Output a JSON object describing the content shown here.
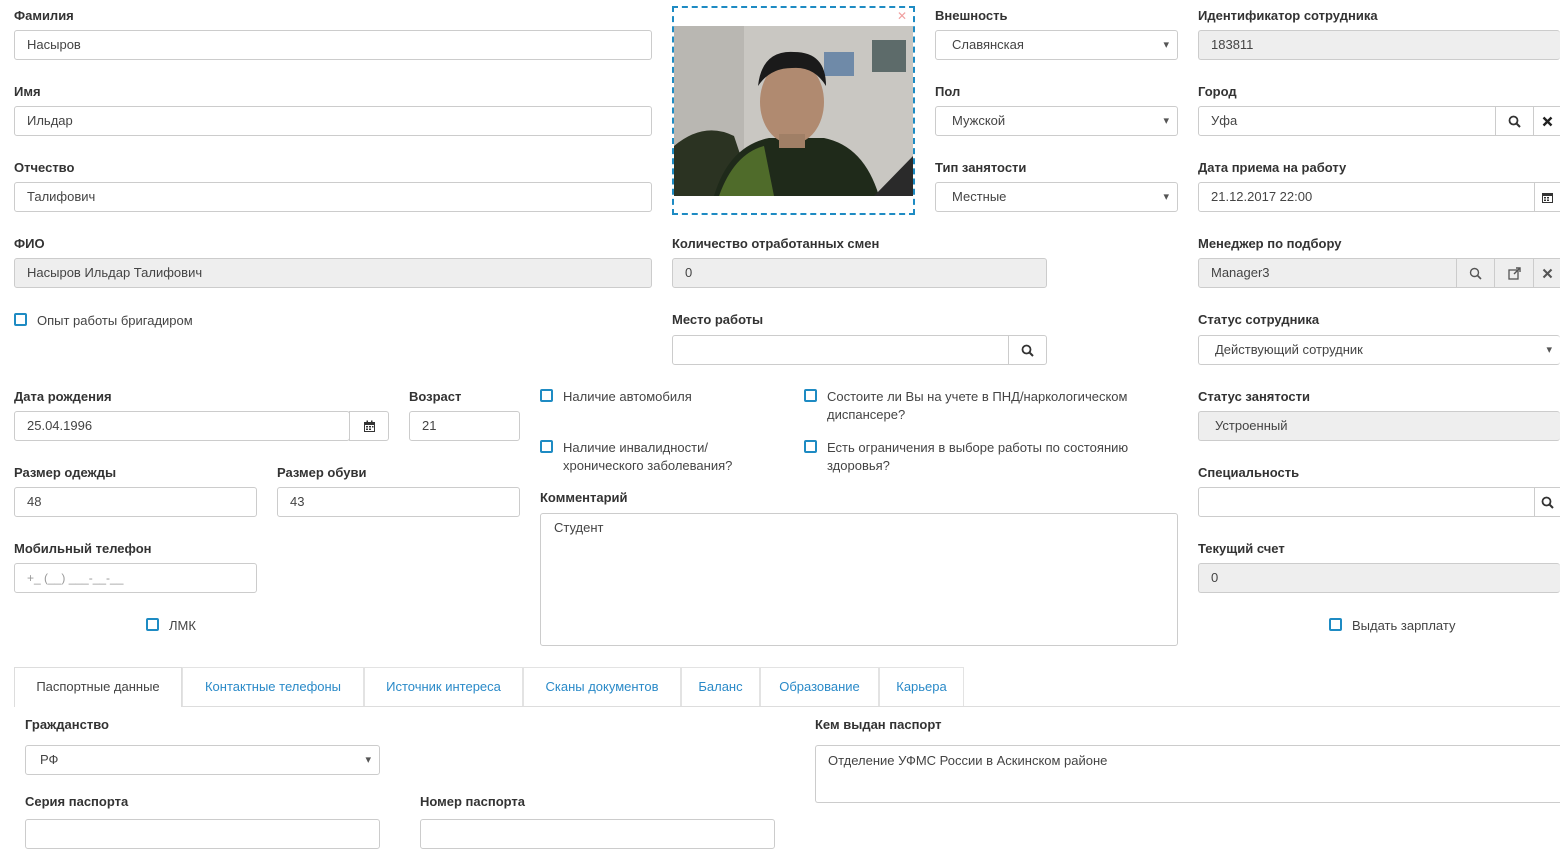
{
  "left": {
    "surname_label": "Фамилия",
    "surname": "Насыров",
    "name_label": "Имя",
    "name": "Ильдар",
    "patronymic_label": "Отчество",
    "patronymic": "Талифович",
    "fio_label": "ФИО",
    "fio": "Насыров Ильдар Талифович",
    "foreman_exp": "Опыт работы бригадиром",
    "birth_label": "Дата рождения",
    "birth": "25.04.1996",
    "age_label": "Возраст",
    "age": "21",
    "clothes_label": "Размер одежды",
    "clothes": "48",
    "shoes_label": "Размер обуви",
    "shoes": "43",
    "phone_label": "Мобильный телефон",
    "phone_placeholder": "+_ (__) ___-__-__",
    "lmk": "ЛМК"
  },
  "middle": {
    "shifts_label": "Количество отработанных смен",
    "shifts": "0",
    "workplace_label": "Место работы",
    "workplace": "",
    "has_car": "Наличие автомобиля",
    "disability": "Наличие инвалидности/ хронического заболевания?",
    "pnd": "Состоите ли Вы на учете в ПНД/наркологическом диспансере?",
    "health_limits": "Есть ограничения в выборе работы по состоянию здоровья?",
    "comment_label": "Комментарий",
    "comment": "Студент"
  },
  "right": {
    "appearance_label": "Внешность",
    "appearance": "Славянская",
    "gender_label": "Пол",
    "gender": "Мужской",
    "employment_type_label": "Тип занятости",
    "employment_type": "Местные",
    "employee_id_label": "Идентификатор сотрудника",
    "employee_id": "183811",
    "city_label": "Город",
    "city": "Уфа",
    "hire_date_label": "Дата приема на работу",
    "hire_date": "21.12.2017 22:00",
    "manager_label": "Менеджер по подбору",
    "manager": "Manager3",
    "status_label": "Статус сотрудника",
    "status": "Действующий сотрудник",
    "employment_status_label": "Статус занятости",
    "employment_status": "Устроенный",
    "specialty_label": "Специальность",
    "specialty": "",
    "account_label": "Текущий счет",
    "account": "0",
    "pay_salary": "Выдать зарплату"
  },
  "tabs": [
    {
      "label": "Паспортные данные"
    },
    {
      "label": "Контактные телефоны"
    },
    {
      "label": "Источник интереса"
    },
    {
      "label": "Сканы документов"
    },
    {
      "label": "Баланс"
    },
    {
      "label": "Образование"
    },
    {
      "label": "Карьера"
    }
  ],
  "passport": {
    "citizenship_label": "Гражданство",
    "citizenship": "РФ",
    "issued_by_label": "Кем выдан паспорт",
    "issued_by": "Отделение УФМС России в Аскинском районе",
    "series_label": "Серия паспорта",
    "number_label": "Номер паспорта"
  },
  "colors": {
    "accent": "#1e8bc3",
    "readonly_bg": "#eeeeee",
    "border": "#cccccc"
  }
}
